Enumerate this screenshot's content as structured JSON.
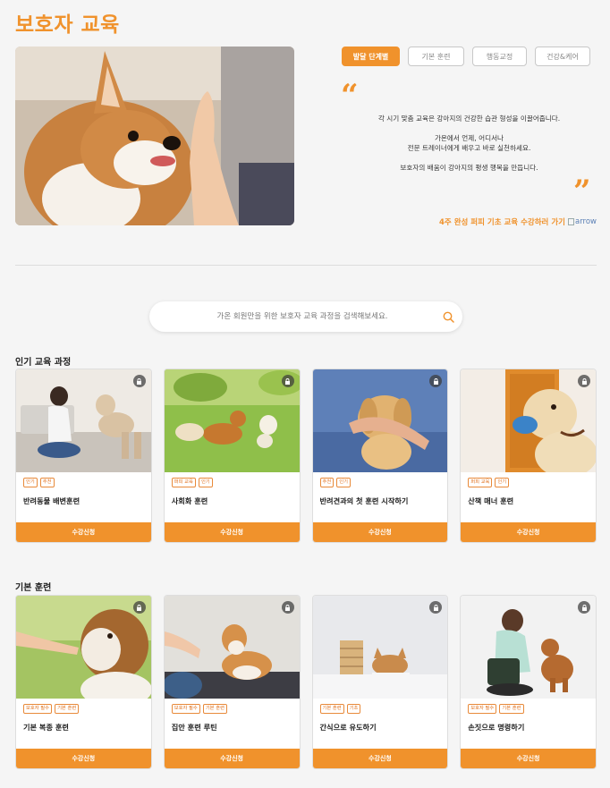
{
  "page": {
    "title": "보호자 교육"
  },
  "tabs": [
    {
      "label": "발달 단계별",
      "active": true
    },
    {
      "label": "기본 훈련",
      "active": false
    },
    {
      "label": "행동교정",
      "active": false
    },
    {
      "label": "건강&케어",
      "active": false
    }
  ],
  "intro": {
    "quote_open": "“",
    "quote_close": "”",
    "line1": "각 시기 맞춤 교육은 강아지의 건강한 습관 형성을 이끌어줍니다.",
    "line2": "가온에서 언제, 어디서나",
    "line3": "전문 트레이너에게 배우고 바로 실천하세요.",
    "line4": "보호자의 배움이 강아지의 평생 행복을 만듭니다.",
    "cta_label": "4주 완성 퍼피 기초 교육 수강하러 가기",
    "cta_img_alt": "arrow"
  },
  "search": {
    "placeholder": "가온 회원만을 위한 보호자 교육 과정을 검색해보세요."
  },
  "sections": {
    "popular": {
      "title": "인기 교육 과정",
      "cards": [
        {
          "badges": [
            "인기",
            "추천"
          ],
          "title": "반려동물 배변훈련",
          "enroll": "수강신청"
        },
        {
          "badges": [
            "퍼피 교육",
            "인기"
          ],
          "title": "사회화 훈련",
          "enroll": "수강신청"
        },
        {
          "badges": [
            "추천",
            "인기"
          ],
          "title": "반려견과의 첫 훈련 시작하기",
          "enroll": "수강신청"
        },
        {
          "badges": [
            "퍼피 교육",
            "인기"
          ],
          "title": "산책 매너 훈련",
          "enroll": "수강신청"
        }
      ]
    },
    "basic": {
      "title": "기본 훈련",
      "cards": [
        {
          "badges": [
            "보호자 필수",
            "기본 훈련"
          ],
          "title": "기본 복종 훈련",
          "enroll": "수강신청"
        },
        {
          "badges": [
            "보호자 필수",
            "기본 훈련"
          ],
          "title": "집안 훈련 루틴",
          "enroll": "수강신청"
        },
        {
          "badges": [
            "기본 훈련",
            "기초"
          ],
          "title": "간식으로 유도하기",
          "enroll": "수강신청"
        },
        {
          "badges": [
            "보호자 필수",
            "기본 훈련"
          ],
          "title": "손짓으로 명령하기",
          "enroll": "수강신청"
        }
      ]
    }
  },
  "colors": {
    "accent": "#f0922c"
  }
}
